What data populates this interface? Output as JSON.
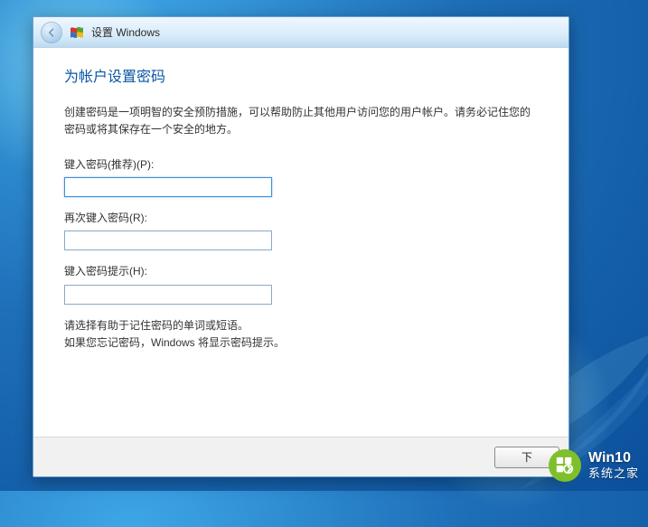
{
  "titlebar": {
    "title": "设置 Windows"
  },
  "page": {
    "heading": "为帐户设置密码",
    "description": "创建密码是一项明智的安全预防措施，可以帮助防止其他用户访问您的用户帐户。请务必记住您的密码或将其保存在一个安全的地方。"
  },
  "fields": {
    "password": {
      "label": "键入密码(推荐)(P):",
      "value": ""
    },
    "confirm": {
      "label": "再次键入密码(R):",
      "value": ""
    },
    "hint": {
      "label": "键入密码提示(H):",
      "value": ""
    }
  },
  "hint_text": {
    "line1": "请选择有助于记住密码的单词或短语。",
    "line2": "如果您忘记密码，Windows 将显示密码提示。"
  },
  "footer": {
    "next_label": "下"
  },
  "watermark": {
    "line1": "Win10",
    "line2": "系统之家"
  }
}
